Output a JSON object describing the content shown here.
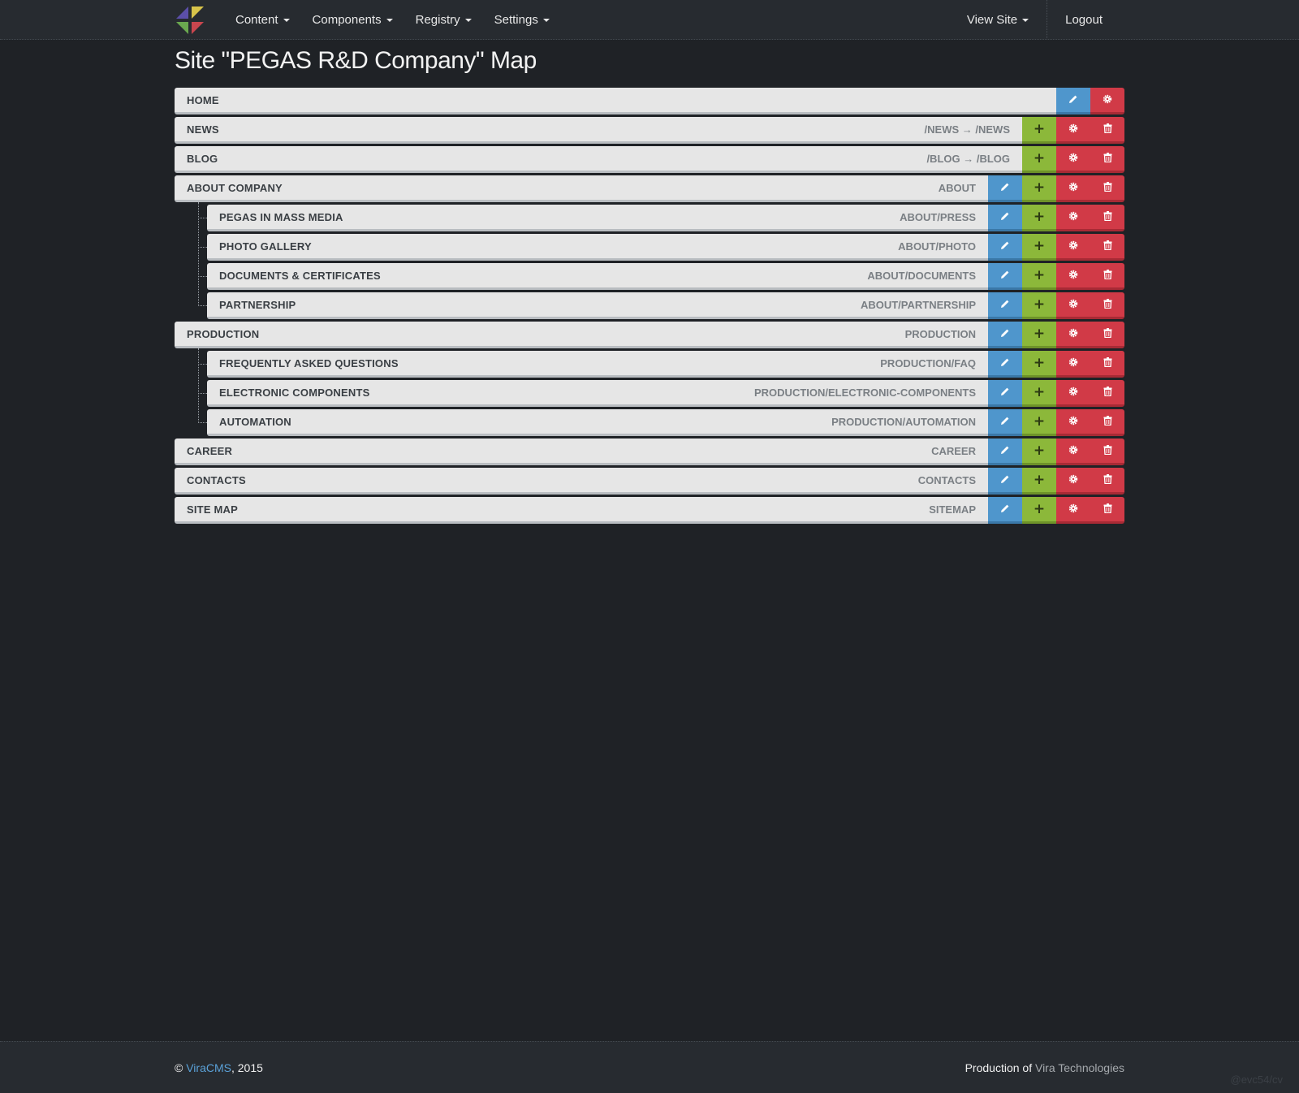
{
  "navbar": {
    "menu": [
      {
        "label": "Content",
        "dropdown": true
      },
      {
        "label": "Components",
        "dropdown": true
      },
      {
        "label": "Registry",
        "dropdown": true
      },
      {
        "label": "Settings",
        "dropdown": true
      }
    ],
    "view_site": "View Site",
    "logout": "Logout"
  },
  "page": {
    "title": "Site \"PEGAS R&D Company\" Map"
  },
  "tree": [
    {
      "label": "HOME",
      "path": "",
      "level": 0,
      "buttons": [
        "edit",
        "settings"
      ]
    },
    {
      "label": "NEWS",
      "path": "/NEWS → /NEWS",
      "level": 0,
      "buttons": [
        "add",
        "settings",
        "delete"
      ]
    },
    {
      "label": "BLOG",
      "path": "/BLOG → /BLOG",
      "level": 0,
      "buttons": [
        "add",
        "settings",
        "delete"
      ]
    },
    {
      "label": "ABOUT COMPANY",
      "path": "ABOUT",
      "level": 0,
      "buttons": [
        "edit",
        "add",
        "settings",
        "delete"
      ]
    },
    {
      "label": "PEGAS IN MASS MEDIA",
      "path": "ABOUT/PRESS",
      "level": 1,
      "buttons": [
        "edit",
        "add",
        "settings",
        "delete"
      ]
    },
    {
      "label": "PHOTO GALLERY",
      "path": "ABOUT/PHOTO",
      "level": 1,
      "buttons": [
        "edit",
        "add",
        "settings",
        "delete"
      ]
    },
    {
      "label": "DOCUMENTS & CERTIFICATES",
      "path": "ABOUT/DOCUMENTS",
      "level": 1,
      "buttons": [
        "edit",
        "add",
        "settings",
        "delete"
      ]
    },
    {
      "label": "PARTNERSHIP",
      "path": "ABOUT/PARTNERSHIP",
      "level": 1,
      "buttons": [
        "edit",
        "add",
        "settings",
        "delete"
      ]
    },
    {
      "label": "PRODUCTION",
      "path": "PRODUCTION",
      "level": 0,
      "buttons": [
        "edit",
        "add",
        "settings",
        "delete"
      ]
    },
    {
      "label": "FREQUENTLY ASKED QUESTIONS",
      "path": "PRODUCTION/FAQ",
      "level": 1,
      "buttons": [
        "edit",
        "add",
        "settings",
        "delete"
      ]
    },
    {
      "label": "ELECTRONIC COMPONENTS",
      "path": "PRODUCTION/ELECTRONIC-COMPONENTS",
      "level": 1,
      "buttons": [
        "edit",
        "add",
        "settings",
        "delete"
      ]
    },
    {
      "label": "AUTOMATION",
      "path": "PRODUCTION/AUTOMATION",
      "level": 1,
      "buttons": [
        "edit",
        "add",
        "settings",
        "delete"
      ]
    },
    {
      "label": "CAREER",
      "path": "CAREER",
      "level": 0,
      "buttons": [
        "edit",
        "add",
        "settings",
        "delete"
      ]
    },
    {
      "label": "CONTACTS",
      "path": "CONTACTS",
      "level": 0,
      "buttons": [
        "edit",
        "add",
        "settings",
        "delete"
      ]
    },
    {
      "label": "SITE MAP",
      "path": "SITEMAP",
      "level": 0,
      "buttons": [
        "edit",
        "add",
        "settings",
        "delete"
      ]
    }
  ],
  "icons": {
    "edit": "pencil-icon",
    "add": "plus-icon",
    "settings": "gear-icon",
    "delete": "trash-icon"
  },
  "colors": {
    "edit": "#4f96cc",
    "add": "#8cb83a",
    "settings": "#d13a47",
    "delete": "#d13a47"
  },
  "footer": {
    "copyright": "©",
    "brand_link": "ViraCMS",
    "year": ", 2015",
    "production_of": "Production of",
    "company_link": "Vira Technologies"
  },
  "watermark": "@evc54/cv"
}
